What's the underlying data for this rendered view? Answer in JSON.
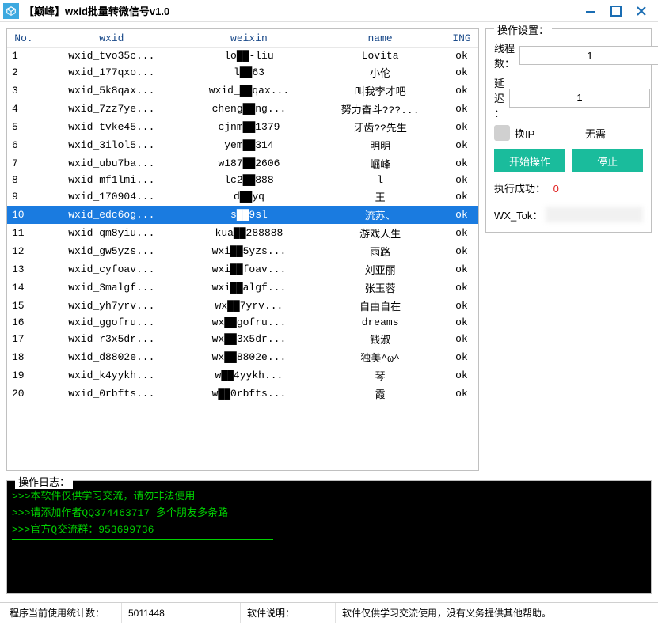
{
  "window": {
    "title": "【巅峰】wxid批量转微信号v1.0"
  },
  "table": {
    "headers": {
      "no": "No.",
      "wxid": "wxid",
      "weixin": "weixin",
      "name": "name",
      "ing": "ING"
    },
    "selected_index": 9,
    "rows": [
      {
        "no": "1",
        "wxid": "wxid_tvo35c...",
        "weixin": "lo██-liu",
        "name": "Lovita",
        "ing": "ok"
      },
      {
        "no": "2",
        "wxid": "wxid_177qxo...",
        "weixin": "l██63",
        "name": "小伦",
        "ing": "ok"
      },
      {
        "no": "3",
        "wxid": "wxid_5k8qax...",
        "weixin": "wxid_██qax...",
        "name": "叫我李才吧",
        "ing": "ok"
      },
      {
        "no": "4",
        "wxid": "wxid_7zz7ye...",
        "weixin": "cheng██ng...",
        "name": "努力奋斗???...",
        "ing": "ok"
      },
      {
        "no": "5",
        "wxid": "wxid_tvke45...",
        "weixin": "cjnm██1379",
        "name": "牙齿??先生",
        "ing": "ok"
      },
      {
        "no": "6",
        "wxid": "wxid_3ilol5...",
        "weixin": "yem██314",
        "name": "明明",
        "ing": "ok"
      },
      {
        "no": "7",
        "wxid": "wxid_ubu7ba...",
        "weixin": "w187██2606",
        "name": "崛峰",
        "ing": "ok"
      },
      {
        "no": "8",
        "wxid": "wxid_mf1lmi...",
        "weixin": "lc2██888",
        "name": "l",
        "ing": "ok"
      },
      {
        "no": "9",
        "wxid": "wxid_170904...",
        "weixin": "d██yq",
        "name": "王",
        "ing": "ok"
      },
      {
        "no": "10",
        "wxid": "wxid_edc6og...",
        "weixin": "s██9sl",
        "name": "流苏、",
        "ing": "ok"
      },
      {
        "no": "11",
        "wxid": "wxid_qm8yiu...",
        "weixin": "kua██288888",
        "name": "游戏人生",
        "ing": "ok"
      },
      {
        "no": "12",
        "wxid": "wxid_gw5yzs...",
        "weixin": "wxi██5yzs...",
        "name": "雨路",
        "ing": "ok"
      },
      {
        "no": "13",
        "wxid": "wxid_cyfoav...",
        "weixin": "wxi██foav...",
        "name": "刘亚丽",
        "ing": "ok"
      },
      {
        "no": "14",
        "wxid": "wxid_3malgf...",
        "weixin": "wxi██algf...",
        "name": "张玉蓉",
        "ing": "ok"
      },
      {
        "no": "15",
        "wxid": "wxid_yh7yrv...",
        "weixin": "wx██7yrv...",
        "name": "自由自在",
        "ing": "ok"
      },
      {
        "no": "16",
        "wxid": "wxid_ggofru...",
        "weixin": "wx██gofru...",
        "name": "dreams",
        "ing": "ok"
      },
      {
        "no": "17",
        "wxid": "wxid_r3x5dr...",
        "weixin": "wx██3x5dr...",
        "name": "钱淑",
        "ing": "ok"
      },
      {
        "no": "18",
        "wxid": "wxid_d8802e...",
        "weixin": "wx██8802e...",
        "name": "独美^ω^",
        "ing": "ok"
      },
      {
        "no": "19",
        "wxid": "wxid_k4yykh...",
        "weixin": "w██4yykh...",
        "name": "琴",
        "ing": "ok"
      },
      {
        "no": "20",
        "wxid": "wxid_0rbfts...",
        "weixin": "w██0rbfts...",
        "name": "霞",
        "ing": "ok"
      }
    ]
  },
  "settings": {
    "legend": "操作设置：",
    "threads_label": "线程数：",
    "threads_value": "1",
    "delay_label": "延 迟 ：",
    "delay_value": "1",
    "ip_label": "换IP",
    "ip_value": "无需",
    "start_label": "开始操作",
    "stop_label": "停止",
    "exec_label": "执行成功：",
    "exec_value": "0",
    "tok_label": "WX_Tok："
  },
  "log": {
    "legend": "操作日志：",
    "lines": [
      ">>>本软件仅供学习交流，请勿非法使用",
      ">>>请添加作者QQ374463717 多个朋友多条路",
      ">>>官方Q交流群：953699736"
    ]
  },
  "status": {
    "usage_label": "程序当前使用统计数：",
    "usage_value": "5011448",
    "desc_label": "软件说明：",
    "desc_value": "软件仅供学习交流使用，没有义务提供其他帮助。"
  }
}
